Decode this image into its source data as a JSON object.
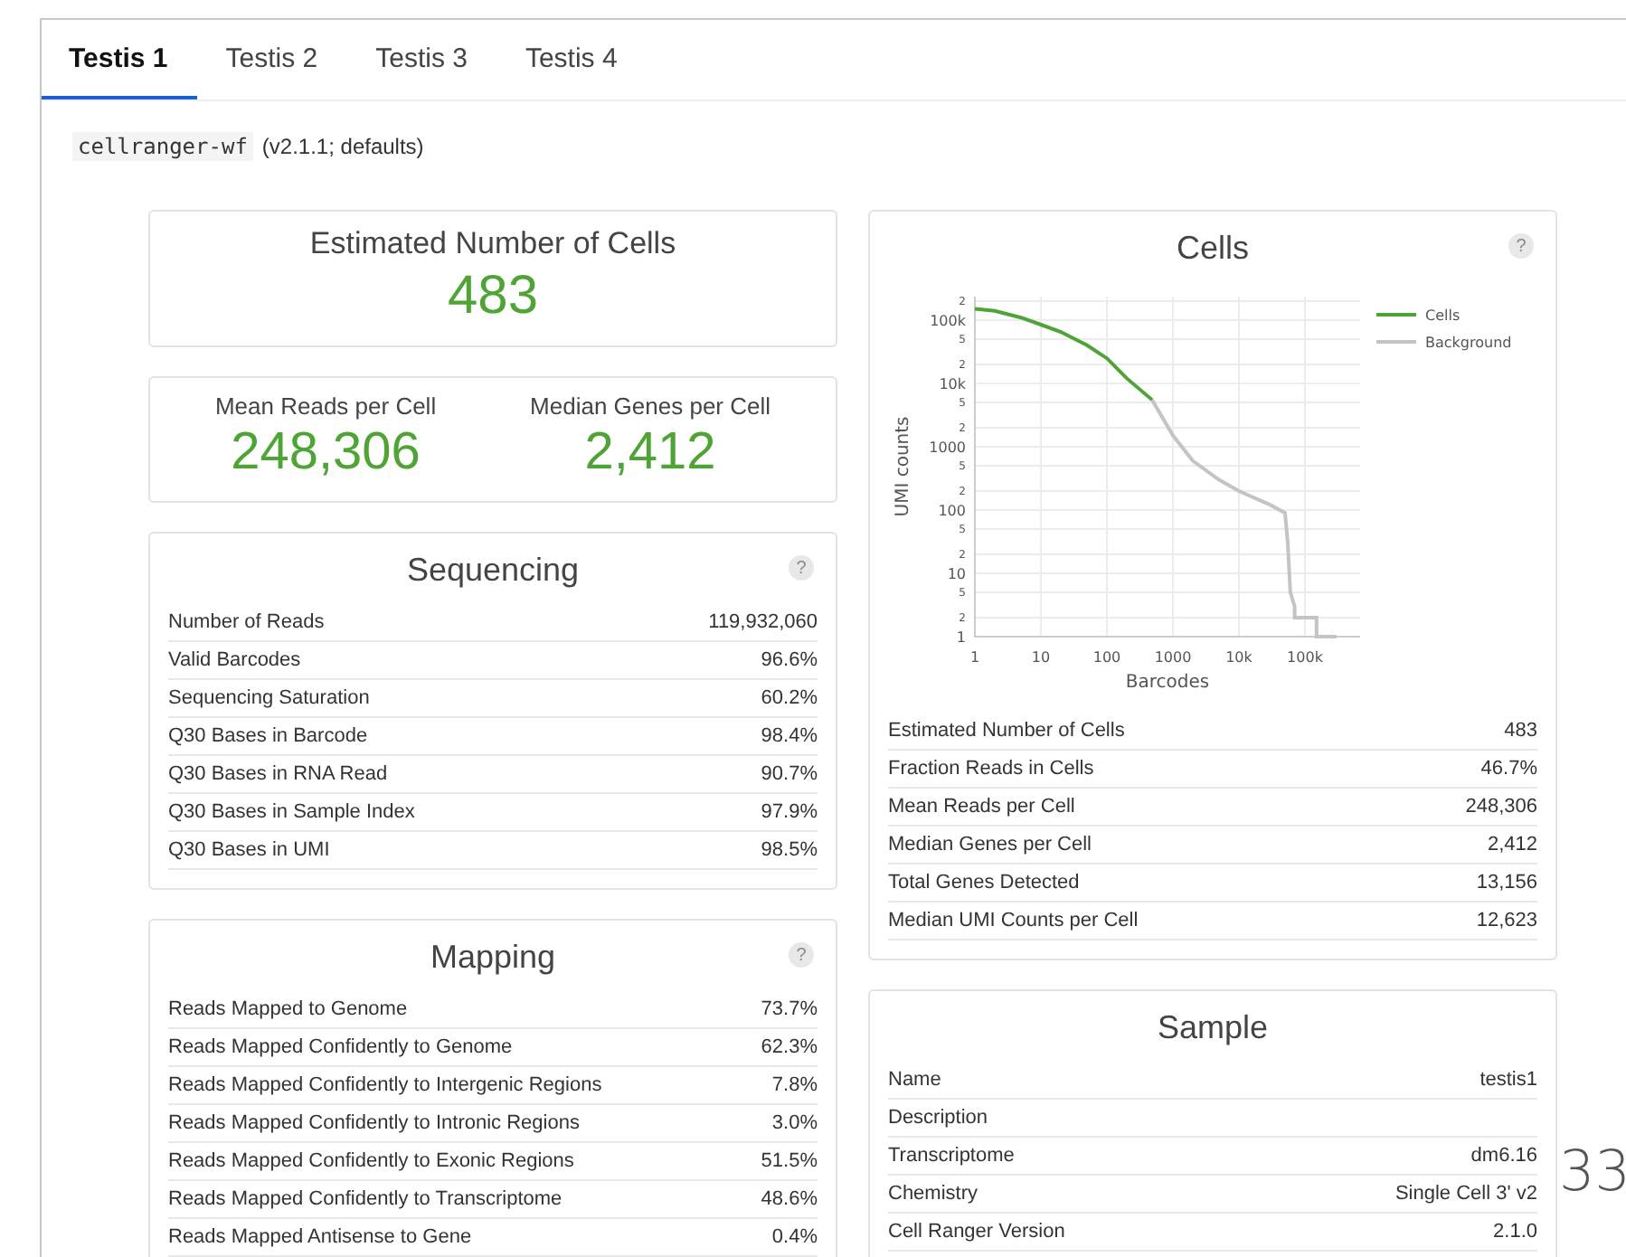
{
  "tabs": [
    {
      "label": "Testis 1",
      "selected": true
    },
    {
      "label": "Testis 2",
      "selected": false
    },
    {
      "label": "Testis 3",
      "selected": false
    },
    {
      "label": "Testis 4",
      "selected": false
    }
  ],
  "pipeline": {
    "name": "cellranger-wf",
    "details": "(v2.1.1; defaults)"
  },
  "left_column": [
    {
      "kind": "hero",
      "metrics": [
        {
          "label": "Estimated Number of Cells",
          "value": "483"
        }
      ]
    },
    {
      "kind": "hero",
      "metrics": [
        {
          "label": "Mean Reads per Cell",
          "value": "248,306"
        },
        {
          "label": "Median Genes per Cell",
          "value": "2,412"
        }
      ]
    },
    {
      "kind": "table",
      "title": "Sequencing",
      "help": "?",
      "rows": [
        {
          "label": "Number of Reads",
          "value": "119,932,060"
        },
        {
          "label": "Valid Barcodes",
          "value": "96.6%"
        },
        {
          "label": "Sequencing Saturation",
          "value": "60.2%"
        },
        {
          "label": "Q30 Bases in Barcode",
          "value": "98.4%"
        },
        {
          "label": "Q30 Bases in RNA Read",
          "value": "90.7%"
        },
        {
          "label": "Q30 Bases in Sample Index",
          "value": "97.9%"
        },
        {
          "label": "Q30 Bases in UMI",
          "value": "98.5%"
        }
      ]
    },
    {
      "kind": "table",
      "title": "Mapping",
      "help": "?",
      "rows": [
        {
          "label": "Reads Mapped to Genome",
          "value": "73.7%"
        },
        {
          "label": "Reads Mapped Confidently to Genome",
          "value": "62.3%"
        },
        {
          "label": "Reads Mapped Confidently to Intergenic Regions",
          "value": "7.8%"
        },
        {
          "label": "Reads Mapped Confidently to Intronic Regions",
          "value": "3.0%"
        },
        {
          "label": "Reads Mapped Confidently to Exonic Regions",
          "value": "51.5%"
        },
        {
          "label": "Reads Mapped Confidently to Transcriptome",
          "value": "48.6%"
        },
        {
          "label": "Reads Mapped Antisense to Gene",
          "value": "0.4%"
        }
      ]
    }
  ],
  "right_column": [
    {
      "kind": "table",
      "title": "Cells",
      "help": "?",
      "plot": {
        "x_axis_title": "Barcodes",
        "y_axis_title": "UMI counts",
        "x_tick_labels": [
          "1",
          "10",
          "100",
          "1000",
          "10k",
          "100k"
        ],
        "y_tick_labels": [
          "2",
          "100k",
          "5",
          "2",
          "10k",
          "5",
          "2",
          "1000",
          "5",
          "2",
          "100",
          "5",
          "2",
          "10",
          "5",
          "2",
          "1"
        ],
        "legend": [
          {
            "name": "Cells",
            "color": "#4fa436"
          },
          {
            "name": "Background",
            "color": "#c4c4c4"
          }
        ]
      },
      "rows": [
        {
          "label": "Estimated Number of Cells",
          "value": "483"
        },
        {
          "label": "Fraction Reads in Cells",
          "value": "46.7%"
        },
        {
          "label": "Mean Reads per Cell",
          "value": "248,306"
        },
        {
          "label": "Median Genes per Cell",
          "value": "2,412"
        },
        {
          "label": "Total Genes Detected",
          "value": "13,156"
        },
        {
          "label": "Median UMI Counts per Cell",
          "value": "12,623"
        }
      ]
    },
    {
      "kind": "table",
      "title": "Sample",
      "rows": [
        {
          "label": "Name",
          "value": "testis1"
        },
        {
          "label": "Description"
        },
        {
          "label": "Transcriptome",
          "value": "dm6.16"
        },
        {
          "label": "Chemistry",
          "value": "Single Cell 3' v2"
        },
        {
          "label": "Cell Ranger Version",
          "value": "2.1.0"
        }
      ]
    }
  ],
  "page_number": "33"
}
